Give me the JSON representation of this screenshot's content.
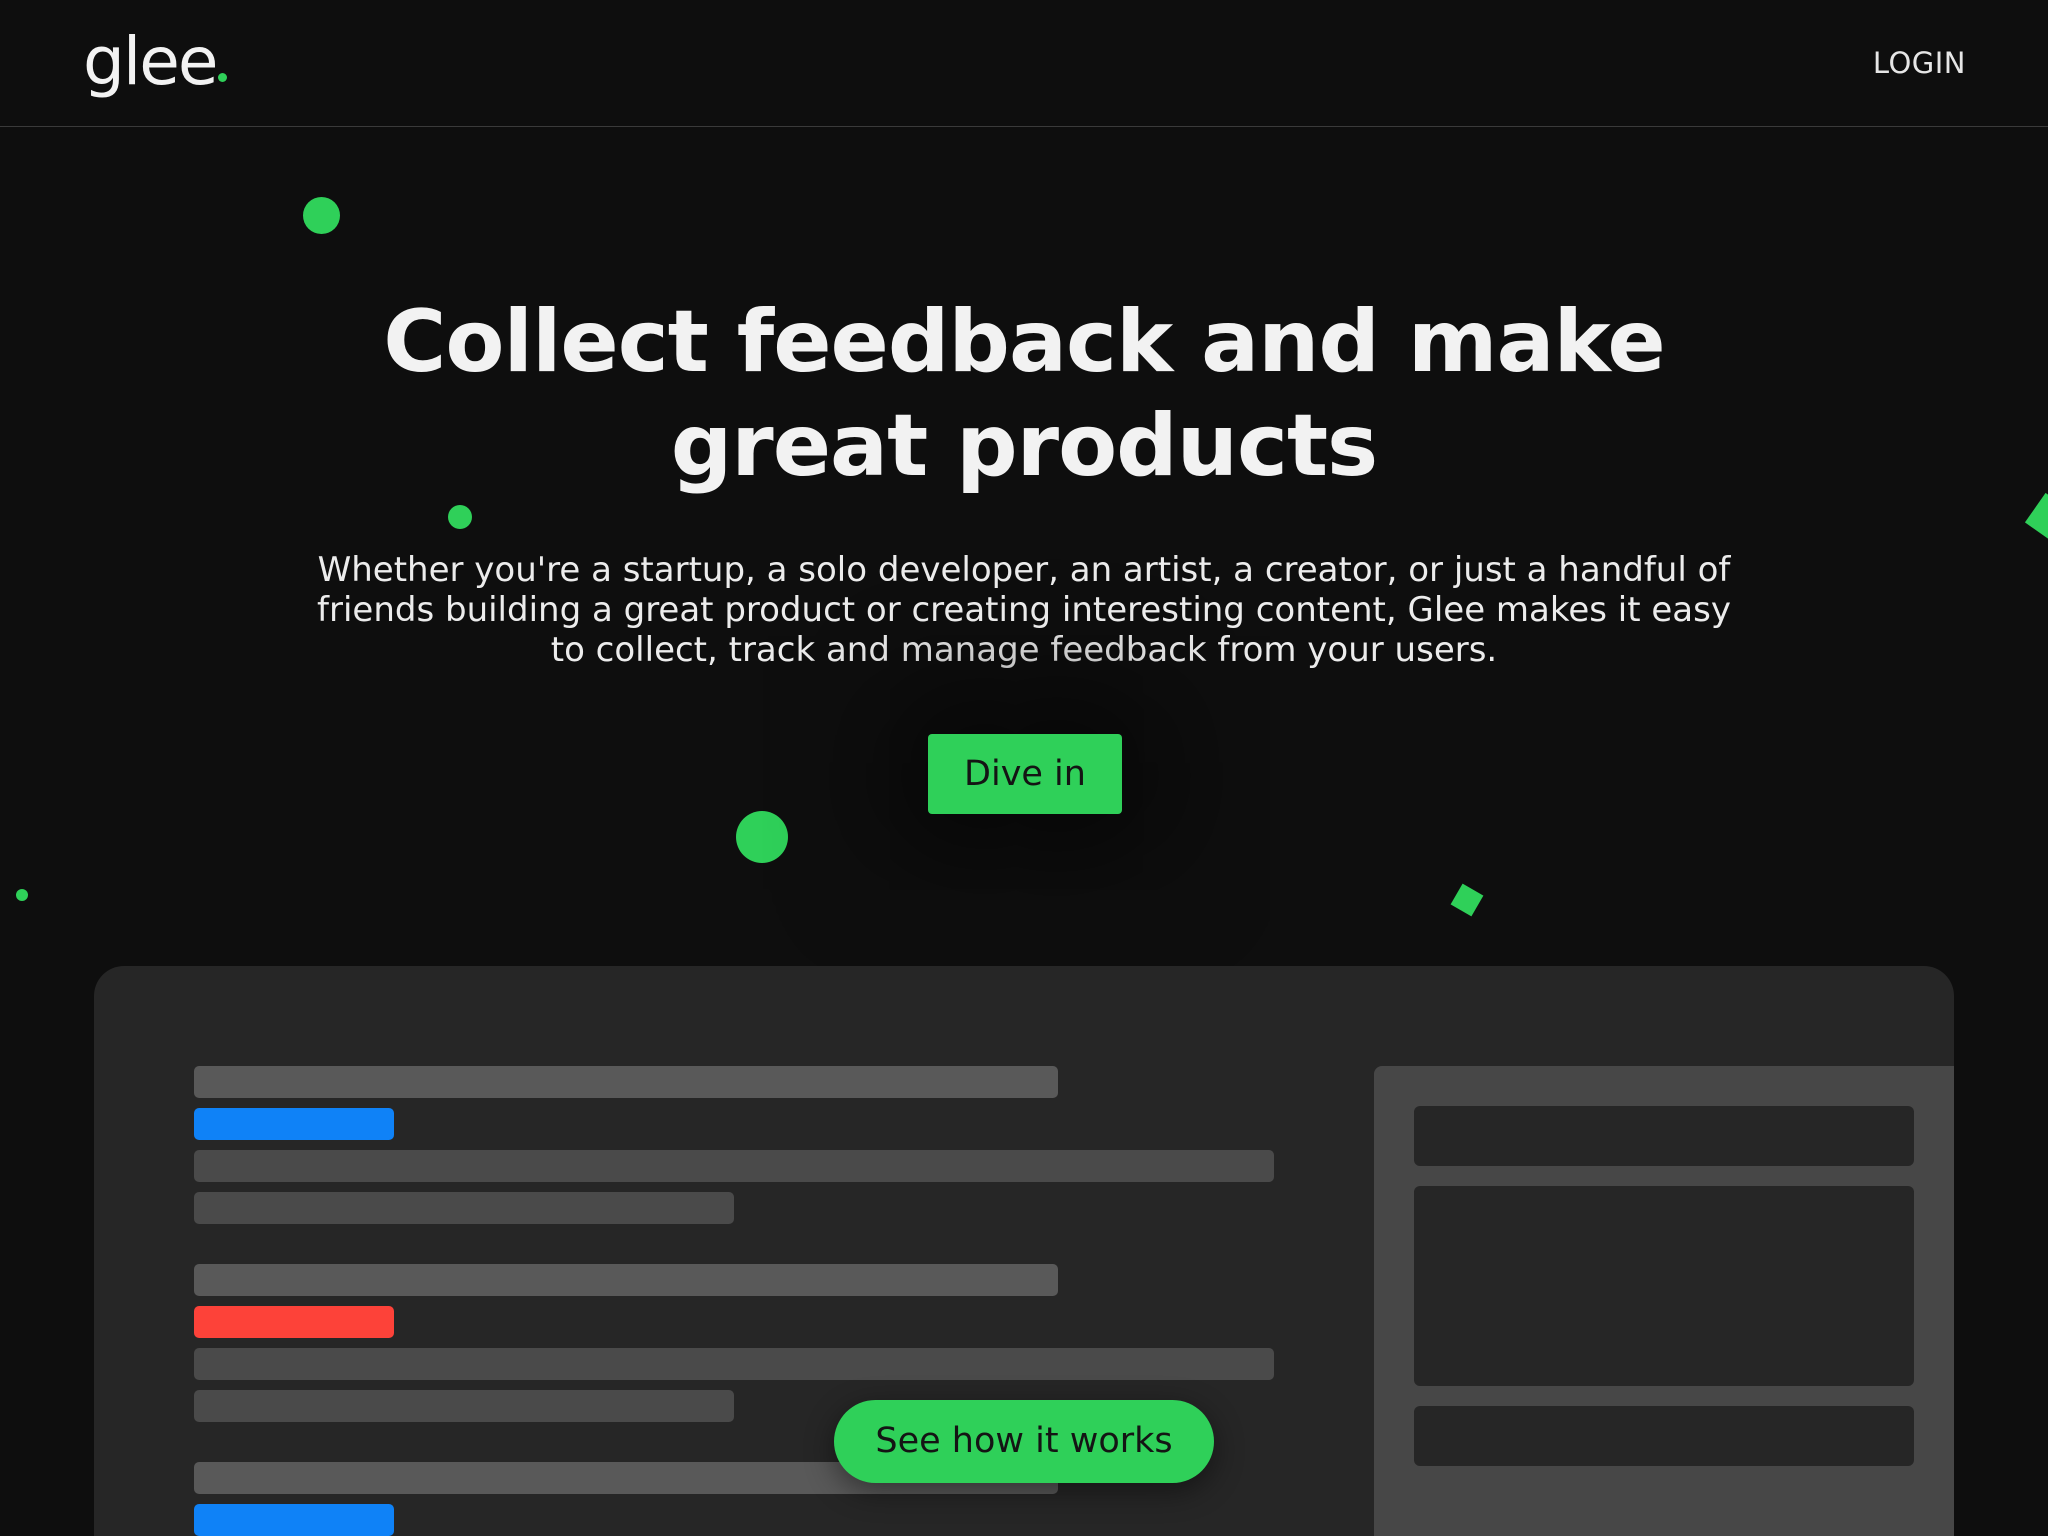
{
  "header": {
    "logo_text": "glee",
    "login_label": "LOGIN"
  },
  "hero": {
    "headline_line1": "Collect feedback and make",
    "headline_line2": "great products",
    "subtext": "Whether you're a startup, a solo developer, an artist, a creator, or just a handful of friends building a great product or creating interesting content, Glee makes it easy to collect, track and manage feedback from your users.",
    "cta_label": "Dive in"
  },
  "preview": {
    "how_label": "See how it works"
  },
  "colors": {
    "accent": "#2fd059",
    "background": "#0e0e0e",
    "panel": "#262626",
    "tag_blue": "#0f82f7",
    "tag_red": "#fd4239"
  }
}
